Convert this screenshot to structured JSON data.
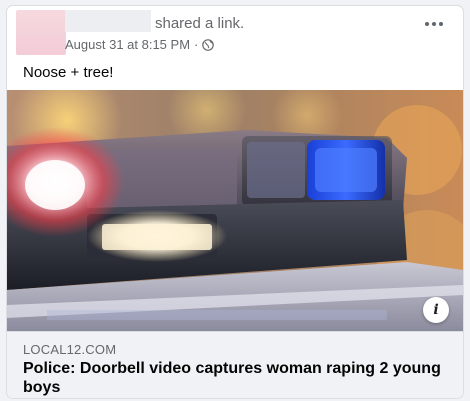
{
  "post": {
    "action_text": "shared a link.",
    "timestamp": "August 31 at 8:15 PM",
    "separator": "·",
    "audience_icon": "globe-icon",
    "more_icon": "more-options-icon",
    "text": "Noose + tree!"
  },
  "link_preview": {
    "image_subject": "police car light bar",
    "domain": "LOCAL12.COM",
    "headline": "Police: Doorbell video captures woman raping 2 young boys",
    "info_icon_glyph": "i"
  },
  "colors": {
    "secondary_text": "#65676b",
    "primary_text": "#050505",
    "card_bg": "#ffffff",
    "link_box_bg": "#f0f2f5",
    "siren_blue": "#2a5bff",
    "siren_red": "#ff3c46"
  }
}
